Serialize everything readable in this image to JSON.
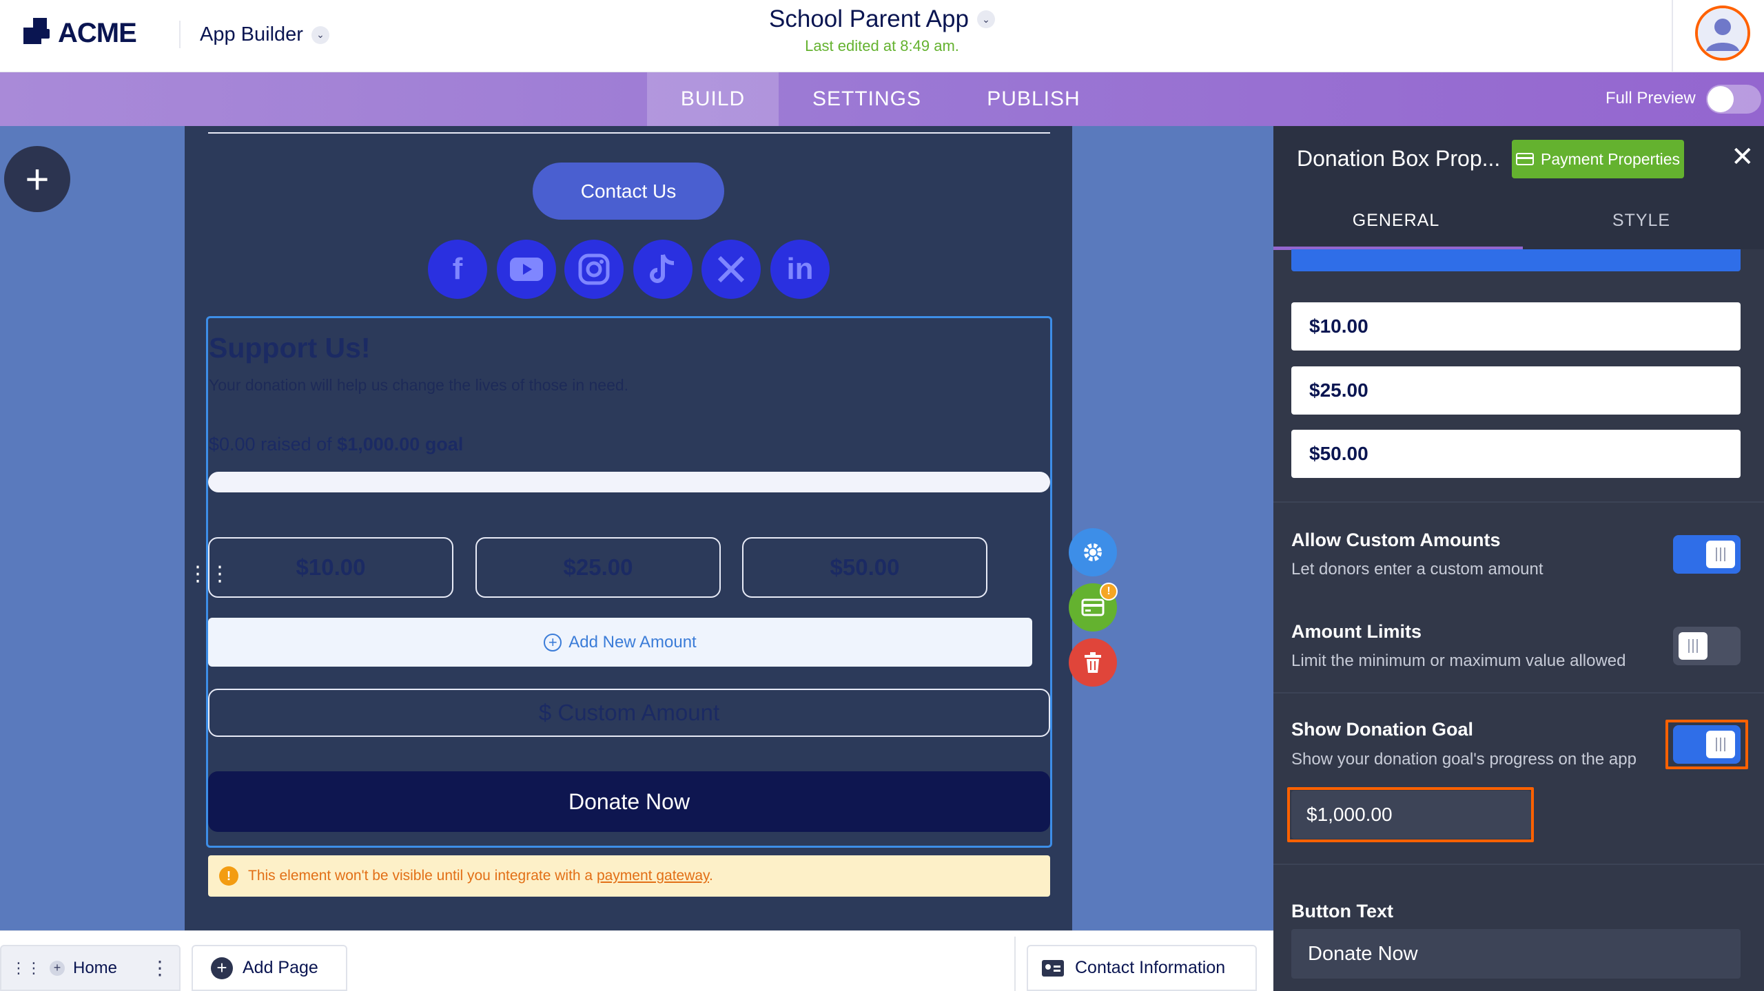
{
  "header": {
    "logo_text": "ACME",
    "app_builder_label": "App Builder",
    "app_title": "School Parent App",
    "last_edited": "Last edited at 8:49 am."
  },
  "nav": {
    "tabs": [
      {
        "label": "BUILD",
        "active": true
      },
      {
        "label": "SETTINGS",
        "active": false
      },
      {
        "label": "PUBLISH",
        "active": false
      }
    ],
    "full_preview_label": "Full Preview",
    "full_preview_on": false
  },
  "canvas": {
    "contact_button": "Contact Us",
    "social_icons": [
      "facebook-icon",
      "youtube-icon",
      "instagram-icon",
      "tiktok-icon",
      "x-icon",
      "linkedin-icon"
    ],
    "donation": {
      "title": "Support Us!",
      "subtitle": "Your donation will help us change the lives of those in need.",
      "raised_amount": "$0.00",
      "raised_text": "raised of",
      "goal_amount": "$1,000.00",
      "goal_text": "goal",
      "progress_fraction": 0,
      "amounts": [
        "$10.00",
        "$25.00",
        "$50.00"
      ],
      "add_amount_label": "Add New Amount",
      "custom_amount_placeholder": "$ Custom Amount",
      "donate_button": "Donate Now"
    },
    "warning": {
      "text": "This element won't be visible until you integrate with a",
      "link": "payment gateway",
      "suffix": "."
    },
    "warning_badge": "!"
  },
  "panel": {
    "title": "Donation Box Prop...",
    "payment_properties_button": "Payment Properties",
    "tabs": [
      {
        "label": "GENERAL",
        "active": true
      },
      {
        "label": "STYLE",
        "active": false
      }
    ],
    "amounts": [
      "$10.00",
      "$25.00",
      "$50.00"
    ],
    "options": [
      {
        "title": "Allow Custom Amounts",
        "desc": "Let donors enter a custom amount",
        "on": true
      },
      {
        "title": "Amount Limits",
        "desc": "Limit the minimum or maximum value allowed",
        "on": false
      },
      {
        "title": "Show Donation Goal",
        "desc": "Show your donation goal's progress on the app",
        "on": true
      }
    ],
    "goal_value": "$1,000.00",
    "button_text_label": "Button Text",
    "button_text_value": "Donate Now"
  },
  "bottom": {
    "home_page": "Home",
    "add_page": "Add Page",
    "contact_information": "Contact Information"
  },
  "colors": {
    "brand_navy": "#0a1551",
    "nav_purple": "#9b78d4",
    "accent_green": "#64b22f",
    "highlight_orange": "#ff6100",
    "toggle_blue": "#2f6ee8"
  }
}
